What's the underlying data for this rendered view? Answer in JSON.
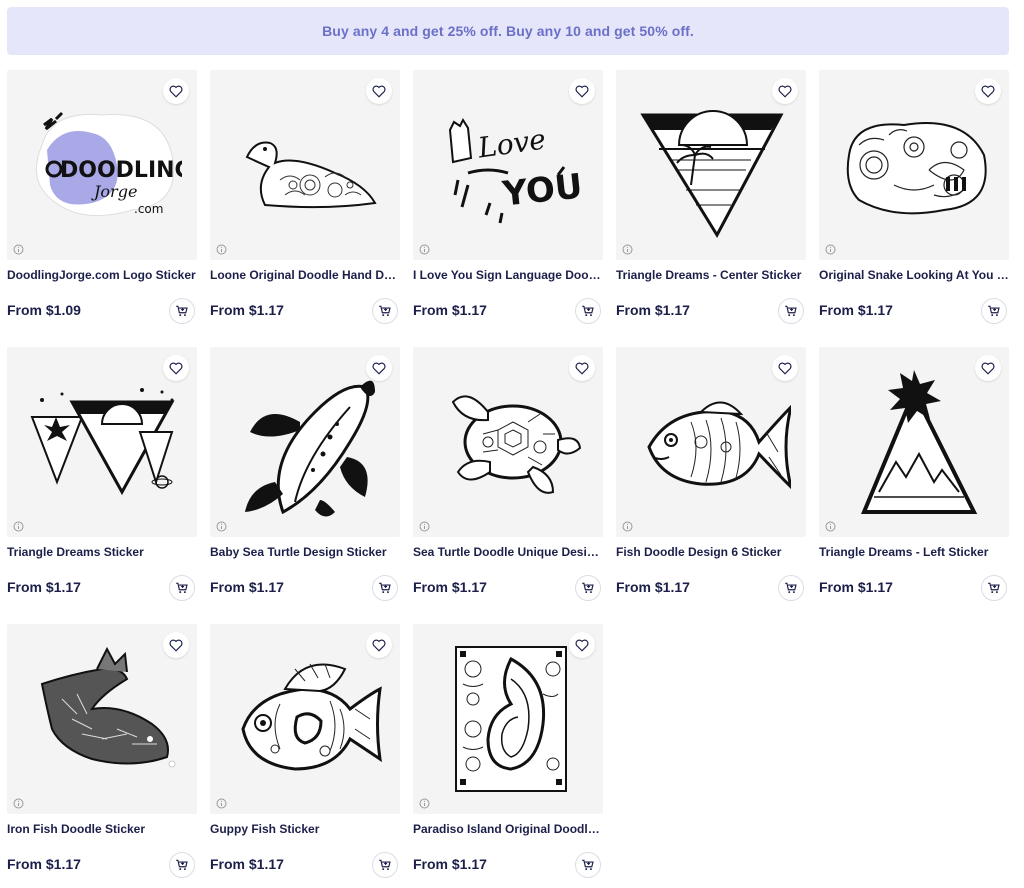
{
  "promo": {
    "text": "Buy any 4 and get 25% off.  Buy any 10 and get 50% off."
  },
  "colors": {
    "accent": "#6a70c8",
    "banner_bg": "#e6e6fa",
    "title": "#1c1f4a",
    "thumb_bg": "#f4f4f4"
  },
  "icons": {
    "favorite": "heart-icon",
    "cart": "add-to-cart-icon",
    "info": "info-icon"
  },
  "products": [
    {
      "title": "DoodlingJorge.com Logo Sticker",
      "price": "From $1.09",
      "art": "logo",
      "logo_text_1": "DOODLING",
      "logo_text_2": "Jorge",
      "logo_text_3": ".com"
    },
    {
      "title": "Loone Original Doodle Hand Dra...",
      "price": "From $1.17",
      "art": "loon"
    },
    {
      "title": "I Love You Sign Language Doodl...",
      "price": "From $1.17",
      "art": "iloveyou",
      "art_text_1": "Love",
      "art_text_2": "YOU"
    },
    {
      "title": "Triangle Dreams - Center Sticker",
      "price": "From $1.17",
      "art": "triangle-center"
    },
    {
      "title": "Original Snake Looking At You S...",
      "price": "From $1.17",
      "art": "snake"
    },
    {
      "title": "Triangle Dreams Sticker",
      "price": "From $1.17",
      "art": "triangles"
    },
    {
      "title": "Baby Sea Turtle Design Sticker",
      "price": "From $1.17",
      "art": "sea-turtle"
    },
    {
      "title": "Sea Turtle Doodle Unique Desig...",
      "price": "From $1.17",
      "art": "turtle-doodle"
    },
    {
      "title": "Fish Doodle Design 6 Sticker",
      "price": "From $1.17",
      "art": "fish"
    },
    {
      "title": "Triangle Dreams - Left Sticker",
      "price": "From $1.17",
      "art": "triangle-left"
    },
    {
      "title": "Iron Fish Doodle Sticker",
      "price": "From $1.17",
      "art": "iron-fish"
    },
    {
      "title": "Guppy Fish Sticker",
      "price": "From $1.17",
      "art": "guppy"
    },
    {
      "title": "Paradiso Island Original Doodle ...",
      "price": "From $1.17",
      "art": "paradiso"
    }
  ]
}
